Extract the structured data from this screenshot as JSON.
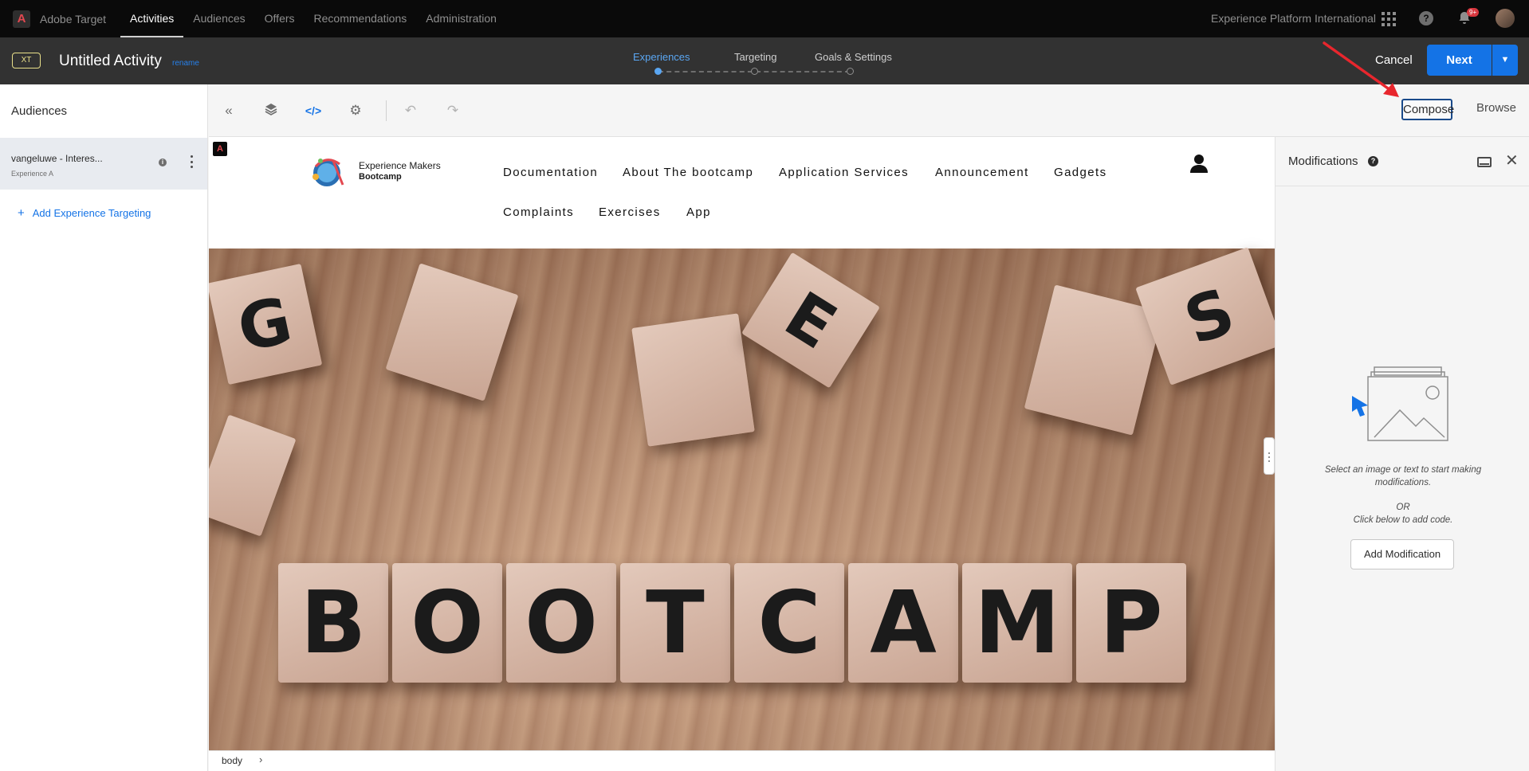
{
  "topnav": {
    "product": "Adobe Target",
    "items": [
      {
        "label": "Activities",
        "active": true
      },
      {
        "label": "Audiences",
        "active": false
      },
      {
        "label": "Offers",
        "active": false
      },
      {
        "label": "Recommendations",
        "active": false
      },
      {
        "label": "Administration",
        "active": false
      }
    ],
    "org": "Experience Platform International",
    "notification_badge": "9+",
    "icons": [
      "apps-grid-icon",
      "help-icon",
      "bell-icon",
      "avatar"
    ]
  },
  "activity": {
    "type_badge": "XT",
    "title": "Untitled Activity",
    "rename": "rename",
    "steps": [
      "Experiences",
      "Targeting",
      "Goals & Settings"
    ],
    "active_step": "Experiences",
    "cancel": "Cancel",
    "next": "Next"
  },
  "audiences": {
    "heading": "Audiences",
    "items": [
      {
        "name": "vangeluwe - Interes...",
        "experience": "Experience A"
      }
    ],
    "add_label": "Add Experience Targeting"
  },
  "toolbar": {
    "tools": [
      "collapse-icon",
      "layers-icon",
      "code-icon",
      "settings-icon",
      "undo-icon",
      "redo-icon"
    ],
    "compose": "Compose",
    "browse": "Browse"
  },
  "site": {
    "logo_line1": "Experience Makers",
    "logo_line2": "Bootcamp",
    "menu_row1": [
      "Documentation",
      "About The bootcamp",
      "Application Services",
      "Announcement",
      "Gadgets"
    ],
    "menu_row2": [
      "Complaints",
      "Exercises",
      "App"
    ],
    "hero_letters": [
      "B",
      "O",
      "O",
      "T",
      "C",
      "A",
      "M",
      "P"
    ]
  },
  "breadcrumb": {
    "element": "body"
  },
  "modifications": {
    "title": "Modifications",
    "empty_line1": "Select an image or text to start making modifications.",
    "or": "OR",
    "empty_line2": "Click below to add code.",
    "add_button": "Add Modification"
  },
  "colors": {
    "accent": "#1473e6",
    "topnav_bg": "#0a0a0a",
    "activity_bar_bg": "#323232",
    "annotation": "#e8262d"
  }
}
